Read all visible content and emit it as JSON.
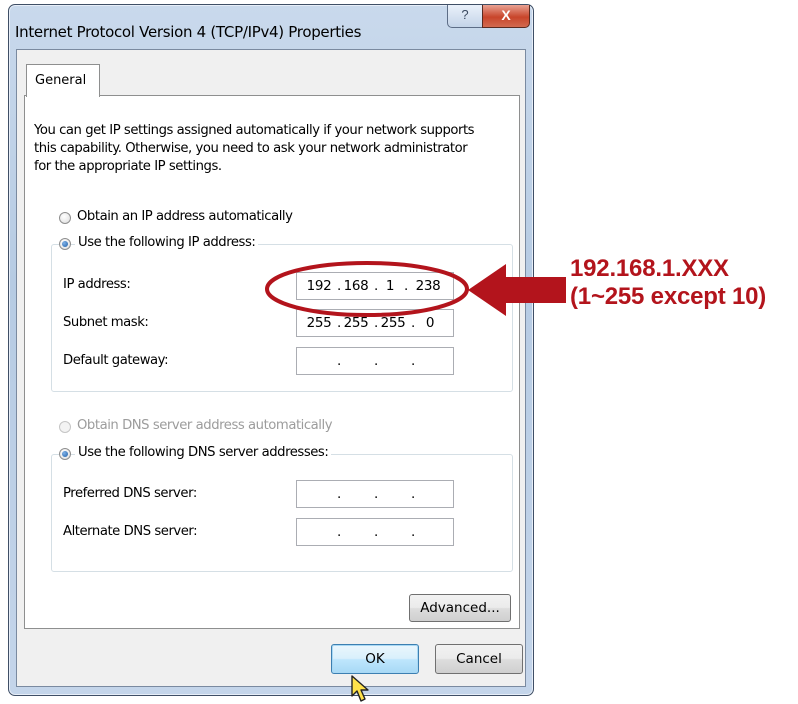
{
  "window": {
    "title": "Internet Protocol Version 4 (TCP/IPv4) Properties",
    "help_glyph": "?",
    "close_glyph": "X"
  },
  "tabs": [
    {
      "label": "General"
    }
  ],
  "general": {
    "description_lines": [
      "You can get IP settings assigned automatically if your network supports",
      "this capability. Otherwise, you need to ask your network administrator",
      "for the appropriate IP settings."
    ],
    "ip_mode": {
      "auto_label": "Obtain an IP address automatically",
      "manual_label": "Use the following IP address:",
      "selected": "manual"
    },
    "ip_fields": [
      {
        "label": "IP address:",
        "octets": [
          "192",
          "168",
          "1",
          "238"
        ]
      },
      {
        "label": "Subnet mask:",
        "octets": [
          "255",
          "255",
          "255",
          "0"
        ]
      },
      {
        "label": "Default gateway:",
        "octets": [
          "",
          "",
          "",
          ""
        ]
      }
    ],
    "dns_mode": {
      "auto_label": "Obtain DNS server address automatically",
      "manual_label": "Use the following DNS server addresses:",
      "selected": "manual",
      "auto_disabled": true
    },
    "dns_fields": [
      {
        "label": "Preferred DNS server:",
        "octets": [
          "",
          "",
          "",
          ""
        ]
      },
      {
        "label": "Alternate DNS server:",
        "octets": [
          "",
          "",
          "",
          ""
        ]
      }
    ],
    "advanced_label": "Advanced..."
  },
  "footer": {
    "ok_label": "OK",
    "cancel_label": "Cancel"
  },
  "annotation": {
    "line1": "192.168.1.XXX",
    "line2": "(1~255 except 10)",
    "color": "#b3141c"
  },
  "colors": {
    "titlebar": "#b6cbe3",
    "close_button": "#c8452b",
    "default_button_border": "#3c7fb1"
  }
}
